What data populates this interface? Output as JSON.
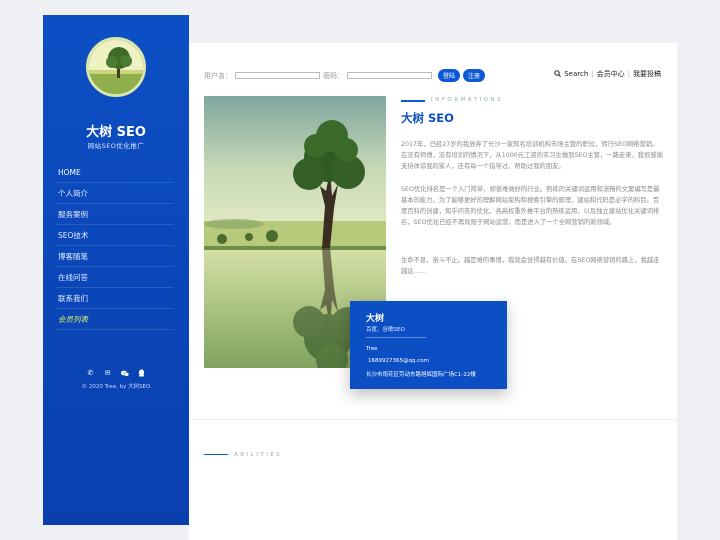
{
  "sidebar": {
    "title": "大树 SEO",
    "subtitle": "网站SEO优化推广",
    "nav": [
      "HOME",
      "个人简介",
      "服务案例",
      "SEO技术",
      "博客随笔",
      "在线问答",
      "联系我们",
      "会员列表"
    ],
    "social_icons": [
      "phone-icon",
      "mail-icon",
      "wechat-icon",
      "qq-icon"
    ],
    "copyright": "© 2020 Tree. by 大树SEO"
  },
  "login": {
    "username_label": "用户名：",
    "password_label": "密码：",
    "login_button": "登陆",
    "register_button": "注册"
  },
  "toplinks": {
    "search": "Search",
    "member_center": "会员中心",
    "submit": "我要投稿"
  },
  "info": {
    "label": "INFORMATIONS",
    "title": "大树 SEO",
    "paragraphs": [
      "2017年，已经27岁的我放弃了长沙一家知名培训机构市场主管的职位，转行SEO网络营销。在没有师傅，没有培训的情况下，从1000元工资的实习生做到SEO主管，一路走来，我很感谢支持体谅我的家人，还有每一个指导过、帮助过我的朋友。",
      "SEO优化排名是一个入门简单，却很难做好的行业。熟练的关键词运用和流畅的文案编写是最基本的能力。为了能够更好的理解网站架构和搜索引擎的原理，建站和代码是必学的科目。百度百科的创建，知乎问答的优化，各高权重外推平台的熟练运用，以及独立建站优化关键词排名，SEO优化已经不再局限于网站运营，而是进入了一个全网营销的新领域。",
      "生命不息，奋斗不止。越是难的事情，我就会觉得越有价值。在SEO网络营销的路上，我越走越远……"
    ]
  },
  "card": {
    "name": "大树",
    "sub": "百度、谷歌SEO",
    "tree": "Tree",
    "email": "1689927365@qq.com",
    "address": "长沙市雨花区劳动东路旭辉国际广场C1-22楼"
  },
  "abilities_label": "ABILITIES"
}
